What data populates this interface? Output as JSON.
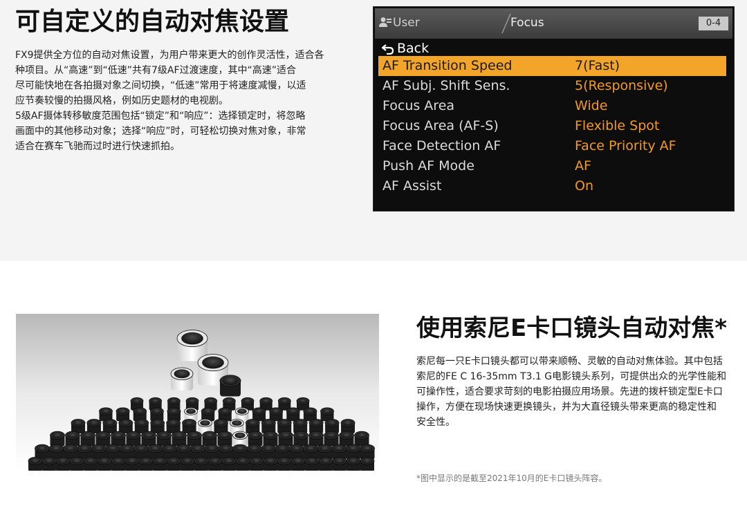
{
  "section1": {
    "title": "可自定义的自动对焦设置",
    "paragraph_lines": [
      "FX9提供全方位的自动对焦设置，为用户带来更大的创作灵活性，适合各",
      "种项目。从“高速”到“低速”共有7级AF过渡速度，其中“高速”适合",
      "尽可能快地在各拍摄对象之间切换，“低速”常用于将速度减慢，以适",
      "应节奏较慢的拍摄风格，例如历史题材的电视剧。",
      "5级AF摄体转移敏度范围包括“锁定”和“响应”：选择锁定时，将忽略",
      "画面中的其他移动对象；选择“响应”时，可轻松切换对焦对象，非常",
      "适合在赛车飞驰而过时进行快速抓拍。"
    ]
  },
  "camera_menu": {
    "tab_user": "User",
    "tab_focus": "Focus",
    "page": "0-4",
    "back": "Back",
    "accent_color": "#f3a52a",
    "value_color": "#f39a22",
    "rows": [
      {
        "label": "AF Transition Speed",
        "value": "7(Fast)",
        "selected": true
      },
      {
        "label": "AF Subj. Shift Sens.",
        "value": "5(Responsive)",
        "selected": false
      },
      {
        "label": "Focus Area",
        "value": "Wide",
        "selected": false
      },
      {
        "label": "Focus Area (AF-S)",
        "value": "Flexible Spot",
        "selected": false
      },
      {
        "label": "Face Detection AF",
        "value": "Face Priority AF",
        "selected": false
      },
      {
        "label": "Push AF Mode",
        "value": "AF",
        "selected": false
      },
      {
        "label": "AF Assist",
        "value": "On",
        "selected": false
      }
    ]
  },
  "section2": {
    "title": "使用索尼E卡口镜头自动对焦*",
    "paragraph_lines": [
      "索尼每一只E卡口镜头都可以带来顺畅、灵敏的自动对焦体验。其中包括",
      "索尼的FE C 16-35mm T3.1 G电影镜头系列，可提供出众的光学性能和",
      "可操作性，适合要求苛刻的电影拍摄应用场景。先进的拨杆锁定型E卡口",
      "操作，方便在现场快速更换镜头，并为大直径镜头带来更高的稳定性和",
      "安全性。"
    ],
    "footnote": "*图中显示的是截至2021年10月的E卡口镜头阵容。"
  }
}
